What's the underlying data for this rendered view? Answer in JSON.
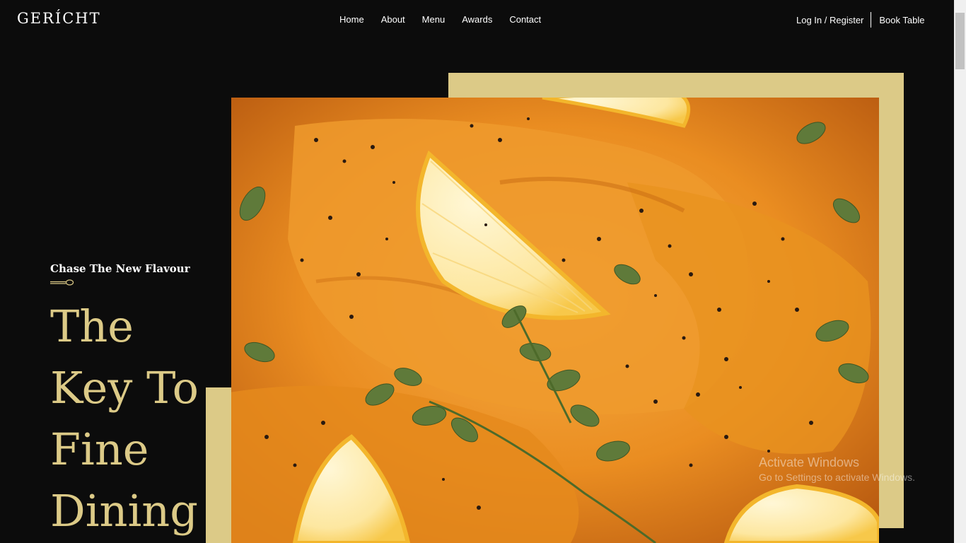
{
  "brand": {
    "logo": "GERÍCHT"
  },
  "nav": {
    "links": [
      "Home",
      "About",
      "Menu",
      "Awards",
      "Contact"
    ],
    "login": "Log In / Register",
    "book": "Book Table"
  },
  "hero": {
    "subtitle": "Chase The New Flavour",
    "title_lines": [
      "The",
      "Key To",
      "Fine",
      "Dining"
    ],
    "image_alt": "Salmon fillets in orange curry sauce with lemon wedges and oregano"
  },
  "watermark": {
    "title": "Activate Windows",
    "subtitle": "Go to Settings to activate Windows."
  },
  "colors": {
    "gold": "#dcca87",
    "background": "#0c0c0c",
    "text": "#ffffff"
  },
  "icons": {
    "spoon": "spoon-icon"
  }
}
